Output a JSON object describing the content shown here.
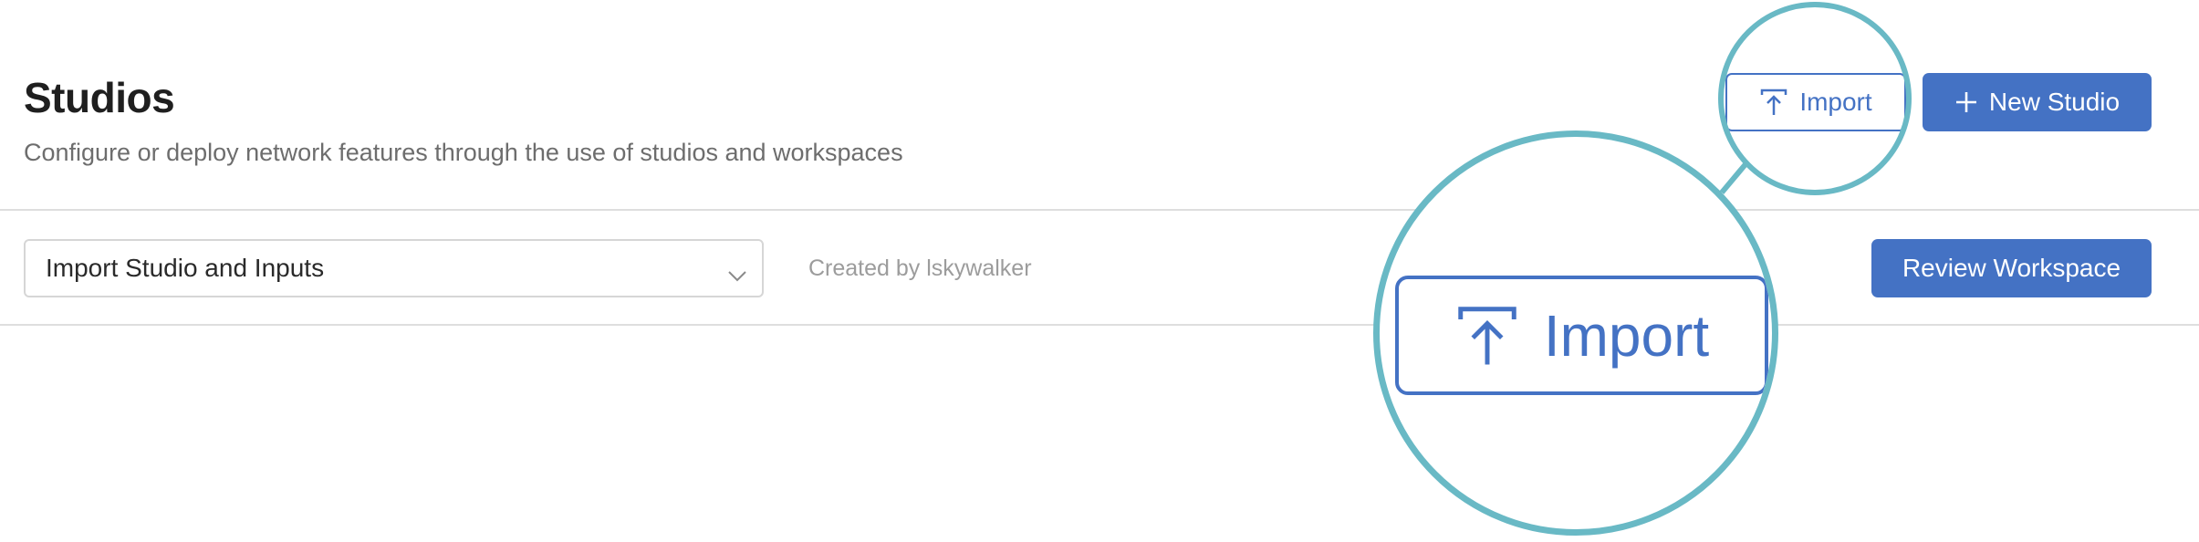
{
  "header": {
    "title": "Studios",
    "subtitle": "Configure or deploy network features through the use of studios and workspaces"
  },
  "toolbar": {
    "import_label": "Import",
    "import_icon": "upload-icon",
    "new_studio_label": "New Studio",
    "new_studio_icon": "plus-icon"
  },
  "workspace_bar": {
    "select_value": "Import Studio and Inputs",
    "select_icon": "chevron-down-icon",
    "created_by": "Created by lskywalker",
    "review_label": "Review Workspace"
  },
  "magnifier": {
    "label": "Import",
    "icon": "upload-icon"
  },
  "colors": {
    "accent": "#4472c4",
    "callout": "#69b9c5",
    "divider": "#dedede",
    "muted_text": "#9c9c9c"
  }
}
